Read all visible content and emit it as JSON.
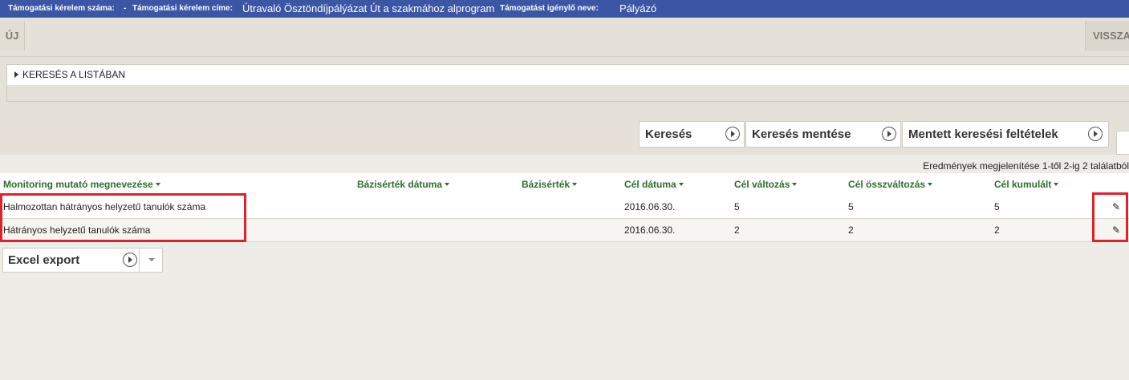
{
  "header": {
    "id_label": "Támogatási kérelem száma:",
    "id_value": "-",
    "title_label": "Támogatási kérelem címe:",
    "title_value": "Útravaló Ösztöndíjpálýázat Út a szakmához alprogram",
    "applicant_label": "Támogatást igénylő neve:",
    "applicant_value": "Pályázó"
  },
  "toolbar": {
    "new_label": "ÚJ",
    "back_label": "VISSZA"
  },
  "search_panel": {
    "title": "KERESÉS A LISTÁBAN"
  },
  "actions": {
    "search": "Keresés",
    "save_search": "Keresés mentése",
    "saved_searches": "Mentett keresési feltételek"
  },
  "results": {
    "count_text": "Eredmények megjelenítése 1-től 2-ig 2 találatból",
    "columns": [
      "Monitoring mutató megnevezése",
      "Bázisérték dátuma",
      "Bázisérték",
      "Cél dátuma",
      "Cél változás",
      "Cél összváltozás",
      "Cél kumulált"
    ],
    "rows": [
      {
        "name": "Halmozottan hátrányos helyzetű tanulók száma",
        "base_date": "",
        "base_value": "",
        "target_date": "2016.06.30.",
        "target_change": "5",
        "target_total_change": "5",
        "target_cumulative": "5"
      },
      {
        "name": "Hátrányos helyzetű tanulók száma",
        "base_date": "",
        "base_value": "",
        "target_date": "2016.06.30.",
        "target_change": "2",
        "target_total_change": "2",
        "target_cumulative": "2"
      }
    ]
  },
  "export": {
    "excel_label": "Excel export"
  },
  "icons": {
    "edit": "pencil-icon",
    "expand": "triangle-right-icon",
    "action": "play-circle-icon",
    "sort": "caret-down-icon"
  },
  "colors": {
    "header_bg": "#3a56a5",
    "column_header_text": "#2e6d2e",
    "highlight": "#e0202a"
  }
}
